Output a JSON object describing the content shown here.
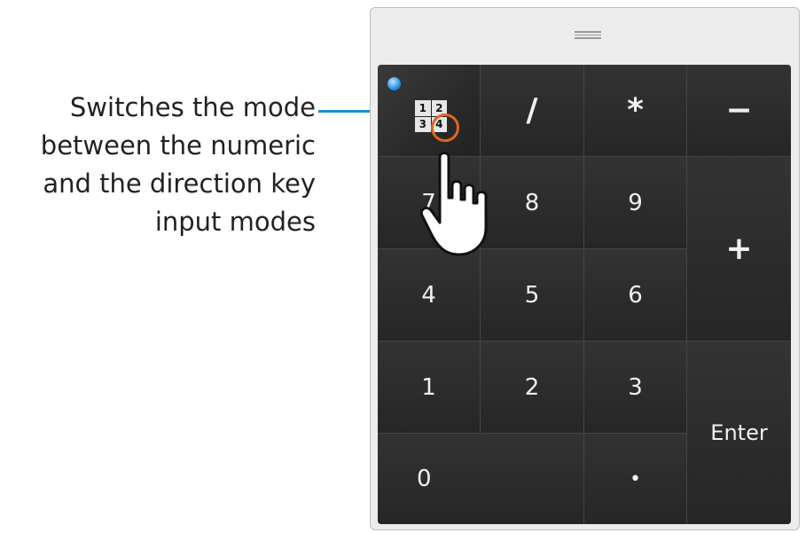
{
  "callout": {
    "line1": "Switches the mode",
    "line2": "between the numeric",
    "line3": "and the direction key",
    "line4": "input modes"
  },
  "keypad": {
    "mode_key": {
      "digits": [
        "1",
        "2",
        "3",
        "4"
      ],
      "icon": "numlock-mode-icon"
    },
    "divide": "/",
    "multiply": "*",
    "minus": "−",
    "k7": "7",
    "k8": "8",
    "k9": "9",
    "plus": "+",
    "k4": "4",
    "k5": "5",
    "k6": "6",
    "k1": "1",
    "k2": "2",
    "k3": "3",
    "enter": "Enter",
    "k0": "0",
    "dot": "•"
  },
  "colors": {
    "accent": "#1a8fd0",
    "highlight_ring": "#e2661c",
    "key_bg": "#2c2c2c",
    "panel_bg": "#ececec"
  }
}
